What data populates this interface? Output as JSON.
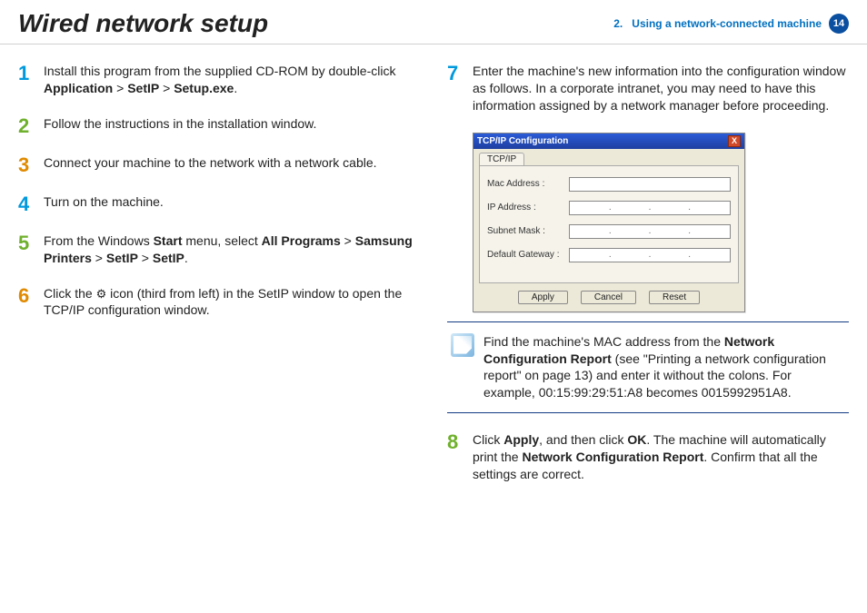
{
  "header": {
    "title": "Wired network setup",
    "chapter_prefix": "2.",
    "chapter_label": "Using a network-connected machine",
    "page_number": "14"
  },
  "steps": {
    "1": {
      "num": "1",
      "pre": "Install this program from the supplied CD-ROM by double-click ",
      "b1": "Application",
      "gt1": " > ",
      "b2": "SetIP",
      "gt2": " > ",
      "b3": "Setup.exe",
      "post": "."
    },
    "2": {
      "num": "2",
      "text": "Follow the instructions in the installation window."
    },
    "3": {
      "num": "3",
      "text": "Connect your machine to the network with a network cable."
    },
    "4": {
      "num": "4",
      "text": "Turn on the machine."
    },
    "5": {
      "num": "5",
      "pre": "From the Windows ",
      "b1": "Start",
      "mid1": " menu, select ",
      "b2": "All Programs",
      "gt1": " > ",
      "b3": "Samsung Printers",
      "gt2": " > ",
      "b4": "SetIP",
      "gt3": " > ",
      "b5": "SetIP",
      "post": "."
    },
    "6": {
      "num": "6",
      "pre": "Click the ",
      "post": " icon (third from left) in the SetIP window to open the TCP/IP configuration window."
    },
    "7": {
      "num": "7",
      "text": "Enter the machine's new information into the configuration window as follows. In a corporate intranet, you may need to have this information assigned by a network manager before proceeding."
    },
    "8": {
      "num": "8",
      "pre": "Click ",
      "b1": "Apply",
      "mid1": ", and then click ",
      "b2": "OK",
      "mid2": ". The machine will automatically print the ",
      "b3": "Network Configuration Report",
      "post": ". Confirm that all the settings are correct."
    }
  },
  "dialog": {
    "title": "TCP/IP Configuration",
    "tab": "TCP/IP",
    "mac_label": "Mac Address :",
    "ip_label": "IP Address :",
    "subnet_label": "Subnet Mask :",
    "gateway_label": "Default Gateway :",
    "apply": "Apply",
    "cancel": "Cancel",
    "reset": "Reset",
    "close_x": "X"
  },
  "note": {
    "pre": "Find the machine's MAC address from the ",
    "b1": "Network Configuration Report",
    "post": " (see \"Printing a network configuration report\" on page 13) and enter it without the colons. For example, 00:15:99:29:51:A8 becomes 0015992951A8."
  }
}
